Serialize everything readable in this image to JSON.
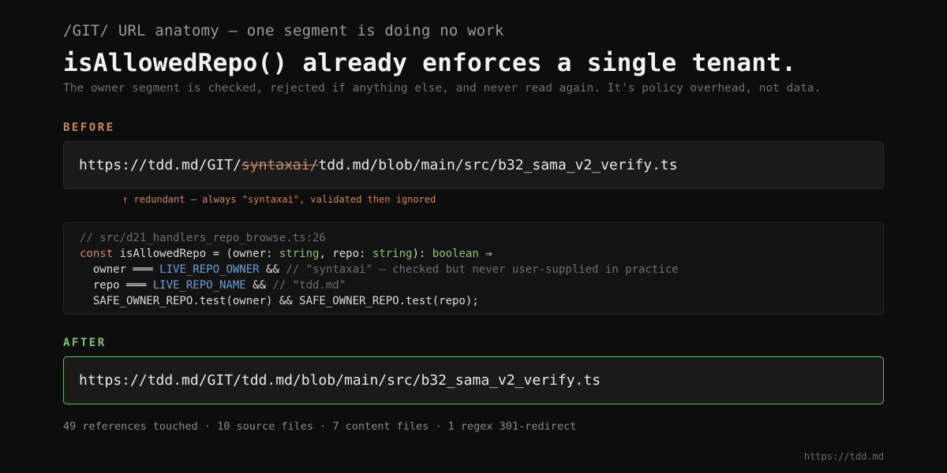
{
  "kicker": "/GIT/ URL anatomy — one segment is doing no work",
  "headline": "isAllowedRepo() already enforces a single tenant.",
  "subtitle": "The owner segment is checked, rejected if anything else, and never read again. It's policy overhead, not data.",
  "before": {
    "label": "BEFORE",
    "url_prefix": "https://tdd.md/GIT/",
    "url_struck": "syntaxai/",
    "url_suffix": "tdd.md/blob/main/src/b32_sama_v2_verify.ts",
    "note": "↑ redundant — always \"syntaxai\", validated then ignored"
  },
  "code": {
    "comment_file": "// src/d21_handlers_repo_browse.ts:26",
    "l2_const": "const",
    "l2_a": " isAllowedRepo = (owner: ",
    "l2_t1": "string",
    "l2_b": ", repo: ",
    "l2_t2": "string",
    "l2_c": "): ",
    "l2_t3": "boolean",
    "l2_d": " ⇒",
    "l3_a": "  owner ═══ ",
    "l3_const": "LIVE_REPO_OWNER",
    "l3_b": " && ",
    "l3_cmt": "// \"syntaxai\" — checked but never user-supplied in practice",
    "l4_a": "  repo ═══ ",
    "l4_const": "LIVE_REPO_NAME",
    "l4_b": " && ",
    "l4_cmt": "// \"tdd.md\"",
    "l5": "  SAFE_OWNER_REPO.test(owner) && SAFE_OWNER_REPO.test(repo);"
  },
  "after": {
    "label": "AFTER",
    "url": "https://tdd.md/GIT/tdd.md/blob/main/src/b32_sama_v2_verify.ts"
  },
  "stats": "49 references touched · 10 source files · 7 content files · 1 regex 301-redirect",
  "footer": "https://tdd.md",
  "colors": {
    "background": "#0d0d0d",
    "before_accent": "#c98a5e",
    "after_accent": "#7fbf7f",
    "type_color": "#8fc06f",
    "const_color": "#6b9fd4"
  }
}
